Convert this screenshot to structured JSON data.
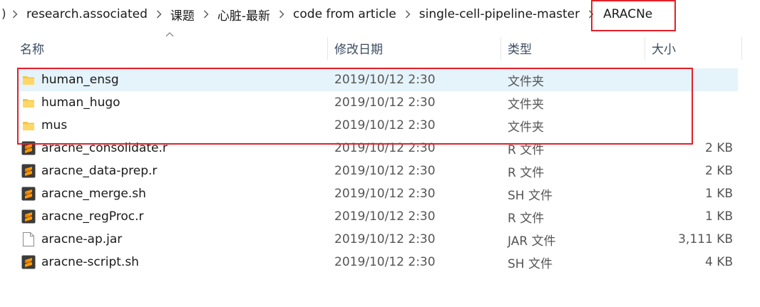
{
  "breadcrumb": {
    "edge": ")",
    "items": [
      "research.associated",
      "课题",
      "心脏-最新",
      "code from article",
      "single-cell-pipeline-master"
    ],
    "current": "ARACNe"
  },
  "columns": {
    "name": "名称",
    "date": "修改日期",
    "type": "类型",
    "size": "大小"
  },
  "files": [
    {
      "name": "human_ensg",
      "date": "2019/10/12 2:30",
      "type": "文件夹",
      "size": "",
      "icon": "folder-icon",
      "selected": true
    },
    {
      "name": "human_hugo",
      "date": "2019/10/12 2:30",
      "type": "文件夹",
      "size": "",
      "icon": "folder-icon"
    },
    {
      "name": "mus",
      "date": "2019/10/12 2:30",
      "type": "文件夹",
      "size": "",
      "icon": "folder-icon"
    },
    {
      "name": "aracne_consolidate.r",
      "date": "2019/10/12 2:30",
      "type": "R 文件",
      "size": "2 KB",
      "icon": "sublime-file-icon"
    },
    {
      "name": "aracne_data-prep.r",
      "date": "2019/10/12 2:30",
      "type": "R 文件",
      "size": "2 KB",
      "icon": "sublime-file-icon"
    },
    {
      "name": "aracne_merge.sh",
      "date": "2019/10/12 2:30",
      "type": "SH 文件",
      "size": "1 KB",
      "icon": "sublime-file-icon"
    },
    {
      "name": "aracne_regProc.r",
      "date": "2019/10/12 2:30",
      "type": "R 文件",
      "size": "1 KB",
      "icon": "sublime-file-icon"
    },
    {
      "name": "aracne-ap.jar",
      "date": "2019/10/12 2:30",
      "type": "JAR 文件",
      "size": "3,111 KB",
      "icon": "blank-file-icon"
    },
    {
      "name": "aracne-script.sh",
      "date": "2019/10/12 2:30",
      "type": "SH 文件",
      "size": "4 KB",
      "icon": "sublime-file-icon"
    }
  ],
  "colors": {
    "annotation": "#e0202a",
    "selection": "#e5f3fb",
    "folder": "#f4c542",
    "sublime": "#ff9800"
  }
}
